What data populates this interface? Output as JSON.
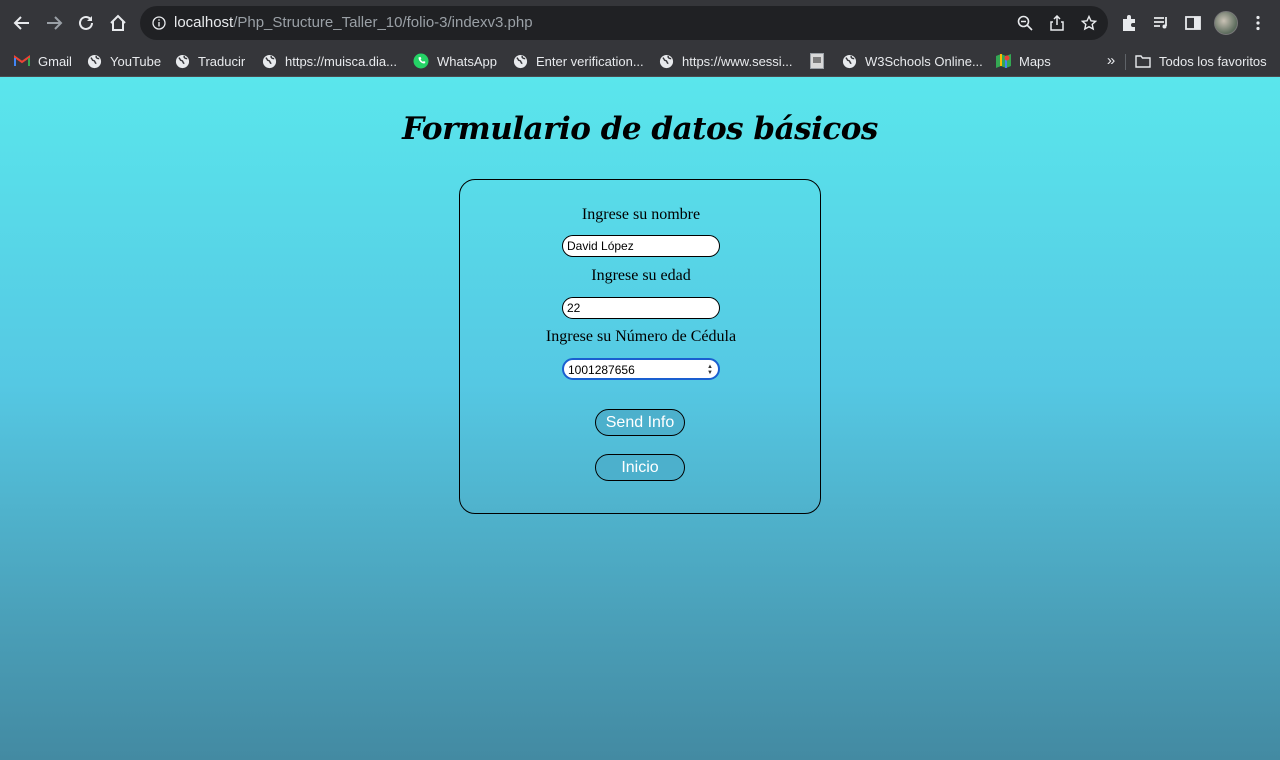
{
  "browser": {
    "url_host": "localhost",
    "url_path": "/Php_Structure_Taller_10/folio-3/indexv3.php",
    "bookmarks": [
      {
        "label": "Gmail",
        "icon": "gmail-icon"
      },
      {
        "label": "YouTube",
        "icon": "globe-icon"
      },
      {
        "label": "Traducir",
        "icon": "globe-icon"
      },
      {
        "label": "https://muisca.dia...",
        "icon": "globe-icon"
      },
      {
        "label": "WhatsApp",
        "icon": "whatsapp-icon"
      },
      {
        "label": "Enter verification...",
        "icon": "globe-icon"
      },
      {
        "label": "https://www.sessi...",
        "icon": "globe-icon"
      },
      {
        "label": "",
        "icon": "page-icon"
      },
      {
        "label": "W3Schools Online...",
        "icon": "globe-icon"
      },
      {
        "label": "Maps",
        "icon": "maps-icon"
      }
    ],
    "all_bookmarks_label": "Todos los favoritos",
    "more_label": "»"
  },
  "page": {
    "title": "Formulario de datos básicos",
    "form": {
      "name_label": "Ingrese su nombre",
      "name_value": "David López",
      "age_label": "Ingrese su edad",
      "age_value": "22",
      "id_label": "Ingrese su Número de Cédula",
      "id_value": "1001287656",
      "send_label": "Send Info",
      "home_label": "Inicio"
    }
  },
  "colors": {
    "chrome_bg": "#35363a",
    "omnibox_bg": "#202124",
    "page_gradient_top": "#5ae6ec",
    "page_gradient_bottom": "#438aa2",
    "button_bg": "#4cb0cc",
    "focus_ring": "#1a5fd0"
  }
}
